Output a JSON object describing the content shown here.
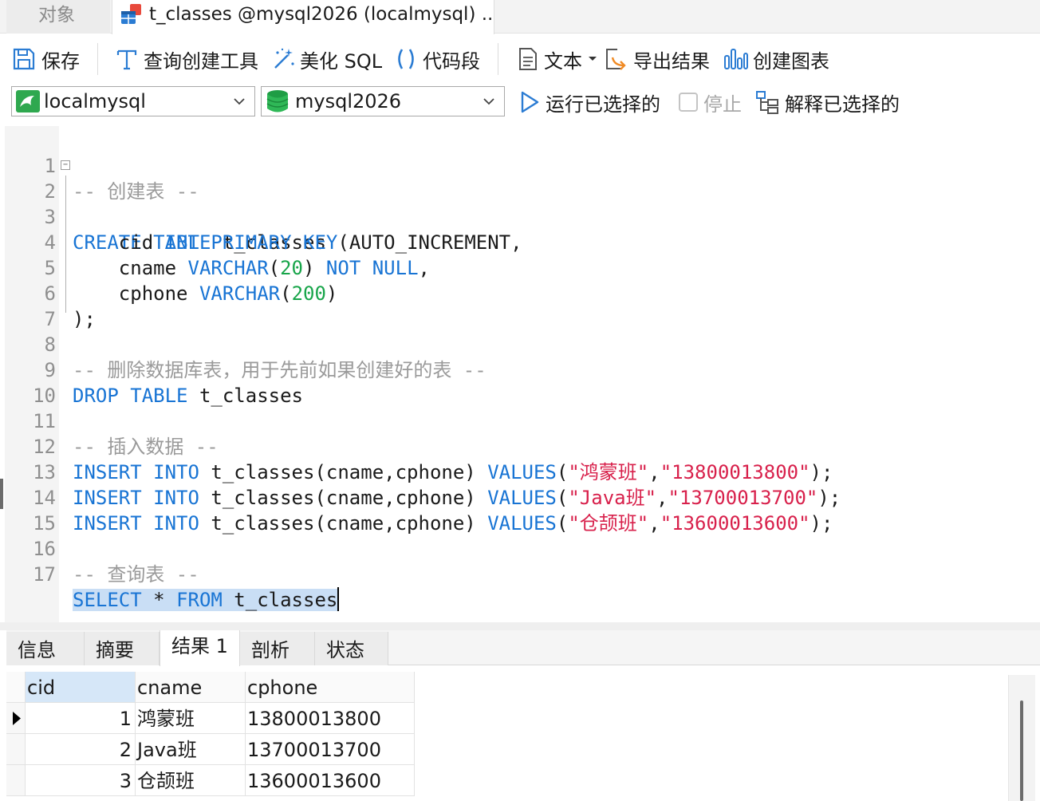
{
  "tabs": {
    "objects_label": "对象",
    "query_label": "t_classes @mysql2026 (localmysql) ..."
  },
  "toolbar": {
    "save": "保存",
    "query_builder": "查询创建工具",
    "beautify_sql": "美化 SQL",
    "code_snippet": "代码段",
    "text": "文本",
    "export_results": "导出结果",
    "create_chart": "创建图表"
  },
  "connection": {
    "connection_name": "localmysql",
    "database_name": "mysql2026",
    "run_selected": "运行已选择的",
    "stop": "停止",
    "explain_selected": "解释已选择的"
  },
  "editor": {
    "line_numbers": [
      "1",
      "2",
      "3",
      "4",
      "5",
      "6",
      "7",
      "8",
      "9",
      "10",
      "11",
      "12",
      "13",
      "14",
      "15",
      "16",
      "17"
    ],
    "l1": "-- 创建表 --",
    "l2_kw1": "CREATE",
    "l2_kw2": "TABLE",
    "l2_rest": " t_classes (",
    "l3_name": "    cid ",
    "l3_kw1": "INT",
    "l3_kw2": "PRIMARY",
    "l3_kw3": "KEY",
    "l3_rest": " AUTO_INCREMENT,",
    "l4_name": "    cname ",
    "l4_kw1": "VARCHAR",
    "l4_open": "(",
    "l4_num": "20",
    "l4_close": ") ",
    "l4_kw2": "NOT",
    "l4_kw3": "NULL",
    "l4_end": ",",
    "l5_name": "    cphone ",
    "l5_kw1": "VARCHAR",
    "l5_open": "(",
    "l5_num": "200",
    "l5_close": ")",
    "l6": ");",
    "l8": "-- 删除数据库表，用于先前如果创建好的表 --",
    "l9_kw1": "DROP",
    "l9_kw2": "TABLE",
    "l9_rest": " t_classes",
    "l11": "-- 插入数据 --",
    "insert_kw1": "INSERT",
    "insert_kw2": "INTO",
    "insert_target": " t_classes(cname,cphone) ",
    "insert_kw3": "VALUES",
    "l12_val1": "\"鸿蒙班\"",
    "l12_val2": "\"13800013800\"",
    "l13_val1": "\"Java班\"",
    "l13_val2": "\"13700013700\"",
    "l14_val1": "\"仓颉班\"",
    "l14_val2": "\"13600013600\"",
    "paren_open": "(",
    "comma": ",",
    "paren_close_semi": ");",
    "l16": "-- 查询表 --",
    "l17_kw1": "SELECT",
    "l17_mid": " * ",
    "l17_kw2": "FROM",
    "l17_rest": " t_classes"
  },
  "results": {
    "tabs": [
      "信息",
      "摘要",
      "结果 1",
      "剖析",
      "状态"
    ],
    "active_tab": "结果 1",
    "columns": [
      "cid",
      "cname",
      "cphone"
    ],
    "rows": [
      [
        "1",
        "鸿蒙班",
        "13800013800"
      ],
      [
        "2",
        "Java班",
        "13700013700"
      ],
      [
        "3",
        "仓颉班",
        "13600013600"
      ]
    ]
  },
  "colors": {
    "keyword": "#1874d4",
    "comment": "#9a9a9a",
    "number": "#18a54a",
    "string": "#d8204b",
    "selection": "#c9def5"
  }
}
